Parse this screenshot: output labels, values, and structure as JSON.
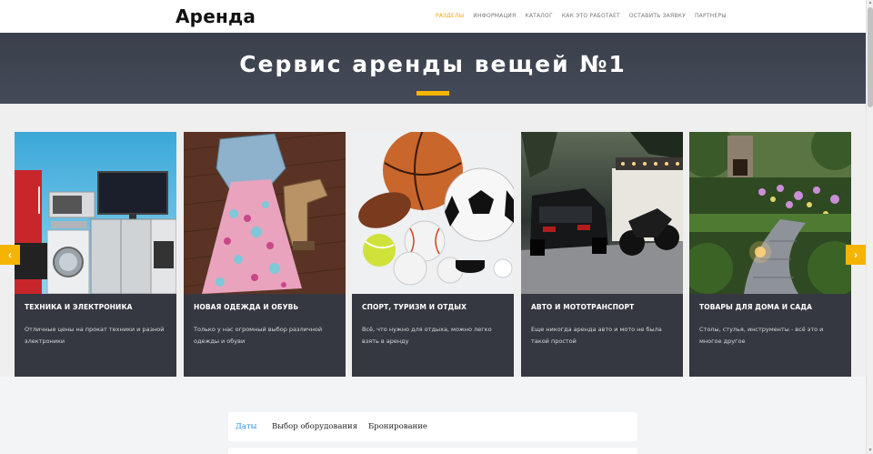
{
  "header": {
    "logo": "Аренда",
    "nav": [
      {
        "label": "РАЗДЕЛЫ",
        "active": true
      },
      {
        "label": "ИНФОРМАЦИЯ",
        "active": false
      },
      {
        "label": "КАТАЛОГ",
        "active": false
      },
      {
        "label": "КАК ЭТО РАБОТАЕТ",
        "active": false
      },
      {
        "label": "ОСТАВИТЬ ЗАЯВКУ",
        "active": false
      },
      {
        "label": "ПАРТНЕРЫ",
        "active": false
      }
    ]
  },
  "hero": {
    "title": "Сервис аренды вещей №1"
  },
  "carousel": {
    "prev_icon": "‹",
    "next_icon": "›",
    "cards": [
      {
        "title": "ТЕХНИКА И ЭЛЕКТРОНИКА",
        "description": "Отличные цены на прокат техники и разной электроники"
      },
      {
        "title": "НОВАЯ ОДЕЖДА И ОБУВЬ",
        "description": "Только у нас огромный выбор различной одежды и обуви"
      },
      {
        "title": "СПОРТ, ТУРИЗМ И ОТДЫХ",
        "description": "Всё, что нужно для отдыха, можно легко взять в аренду"
      },
      {
        "title": "АВТО И МОТОТРАНСПОРТ",
        "description": "Еще никогда аренда авто и мото не была такой простой"
      },
      {
        "title": "ТОВАРЫ ДЛЯ ДОМА И САДА",
        "description": "Столы, стулья, инструменты - всё это и многое другое"
      }
    ]
  },
  "booking": {
    "tabs": [
      {
        "label": "Даты",
        "active": true
      },
      {
        "label": "Выбор оборудования",
        "active": false
      },
      {
        "label": "Бронирование",
        "active": false
      }
    ]
  },
  "colors": {
    "accent": "#f5b400",
    "nav_active": "#f0a800",
    "card_bg": "#353840",
    "tab_active": "#2b8de0"
  }
}
